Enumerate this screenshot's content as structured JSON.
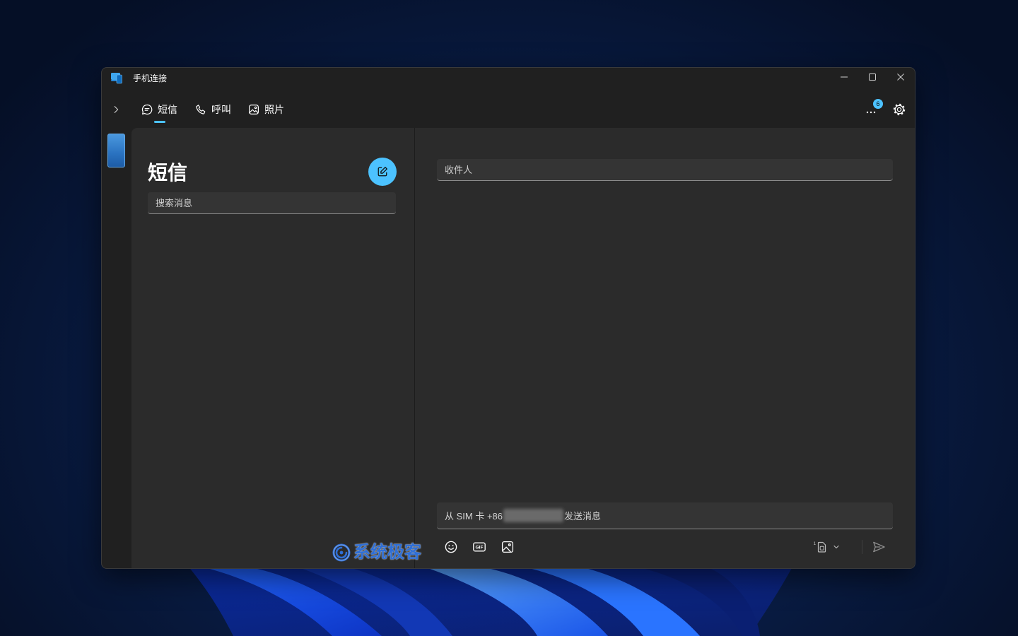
{
  "desktop": {
    "colors": {
      "background": "#08193d",
      "bloom_light": "#4d9bff",
      "bloom_dark": "#0a2a9c"
    }
  },
  "window": {
    "title": "手机连接",
    "app_icon": "phone-link-icon",
    "controls": {
      "minimize_icon": "minimize-icon",
      "maximize_icon": "maximize-icon",
      "close_icon": "close-icon"
    }
  },
  "nav": {
    "expand_icon": "chevron-right-icon",
    "tabs": [
      {
        "label": "短信",
        "icon": "message-icon",
        "active": true
      },
      {
        "label": "呼叫",
        "icon": "phone-icon",
        "active": false
      },
      {
        "label": "照片",
        "icon": "photo-icon",
        "active": false
      }
    ],
    "more_icon": "more-icon",
    "notification_count": "6",
    "settings_icon": "gear-icon"
  },
  "rail": {
    "device_icon": "phone-thumbnail-icon"
  },
  "messages_panel": {
    "title": "短信",
    "compose_icon": "compose-icon",
    "search": {
      "placeholder": "搜索消息",
      "value": ""
    }
  },
  "conversation": {
    "recipient": {
      "placeholder": "收件人",
      "value": ""
    },
    "message": {
      "placeholder_prefix": "从 SIM 卡 +86",
      "placeholder_suffix": "发送消息"
    },
    "toolbar": {
      "emoji_icon": "emoji-icon",
      "gif_icon": "gif-icon",
      "gif_label": "GIF",
      "image_icon": "image-icon",
      "sim_icon": "sim-card-icon",
      "sim_slot": "1",
      "sim_dropdown_icon": "chevron-down-icon",
      "send_icon": "send-icon"
    }
  },
  "watermark": {
    "text": "系统极客",
    "logo_icon": "watermark-logo-icon"
  },
  "colors": {
    "accent": "#4cc2ff",
    "window_bg": "#202020",
    "panel_bg": "#2b2b2b",
    "input_bg": "#343434",
    "text": "#ffffff"
  }
}
